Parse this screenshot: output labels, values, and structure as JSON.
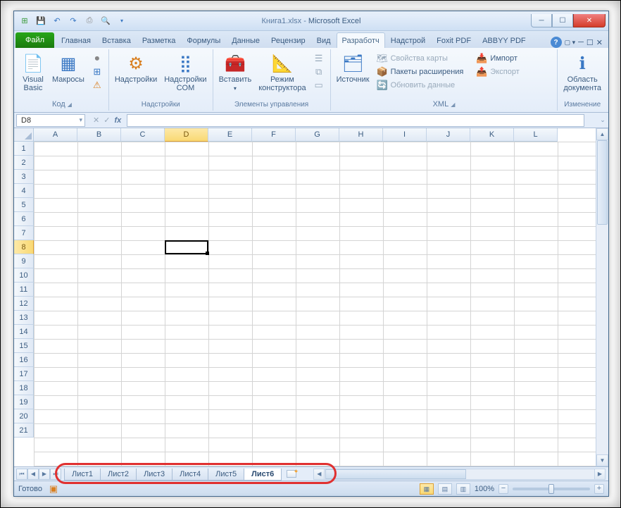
{
  "window": {
    "title_file": "Книга1.xlsx",
    "title_app": "Microsoft Excel"
  },
  "qat": [
    "excel",
    "save",
    "undo",
    "redo",
    "print",
    "preview",
    "new"
  ],
  "ribbon_tabs": {
    "file": "Файл",
    "items": [
      "Главная",
      "Вставка",
      "Разметка",
      "Формулы",
      "Данные",
      "Рецензир",
      "Вид",
      "Разработч",
      "Надстрой",
      "Foxit PDF",
      "ABBYY PDF"
    ],
    "active_index": 7
  },
  "ribbon": {
    "code": {
      "label": "Код",
      "vb": "Visual\nBasic",
      "macros": "Макросы",
      "s1": "",
      "s2": "",
      "s3": ""
    },
    "addins": {
      "label": "Надстройки",
      "addins": "Надстройки",
      "com": "Надстройки\nCOM"
    },
    "controls": {
      "label": "Элементы управления",
      "insert": "Вставить",
      "design": "Режим\nконструктора",
      "s1": "",
      "s2": "",
      "s3": ""
    },
    "xml": {
      "label": "XML",
      "source": "Источник",
      "map_props": "Свойства карты",
      "expansion": "Пакеты расширения",
      "refresh": "Обновить данные",
      "import": "Импорт",
      "export": "Экспорт"
    },
    "docpanel": {
      "label": "Изменение",
      "panel": "Область\nдокумента"
    }
  },
  "formula_bar": {
    "name_box": "D8",
    "fx": "fx",
    "value": ""
  },
  "grid": {
    "columns": [
      "A",
      "B",
      "C",
      "D",
      "E",
      "F",
      "G",
      "H",
      "I",
      "J",
      "K",
      "L"
    ],
    "rows": [
      "1",
      "2",
      "3",
      "4",
      "5",
      "6",
      "7",
      "8",
      "9",
      "10",
      "11",
      "12",
      "13",
      "14",
      "15",
      "16",
      "17",
      "18",
      "19",
      "20",
      "21"
    ],
    "selected_col": 3,
    "selected_row": 7
  },
  "sheets": {
    "items": [
      "Лист1",
      "Лист2",
      "Лист3",
      "Лист4",
      "Лист5",
      "Лист6"
    ],
    "active_index": 5
  },
  "status": {
    "ready": "Готово",
    "zoom": "100%"
  }
}
